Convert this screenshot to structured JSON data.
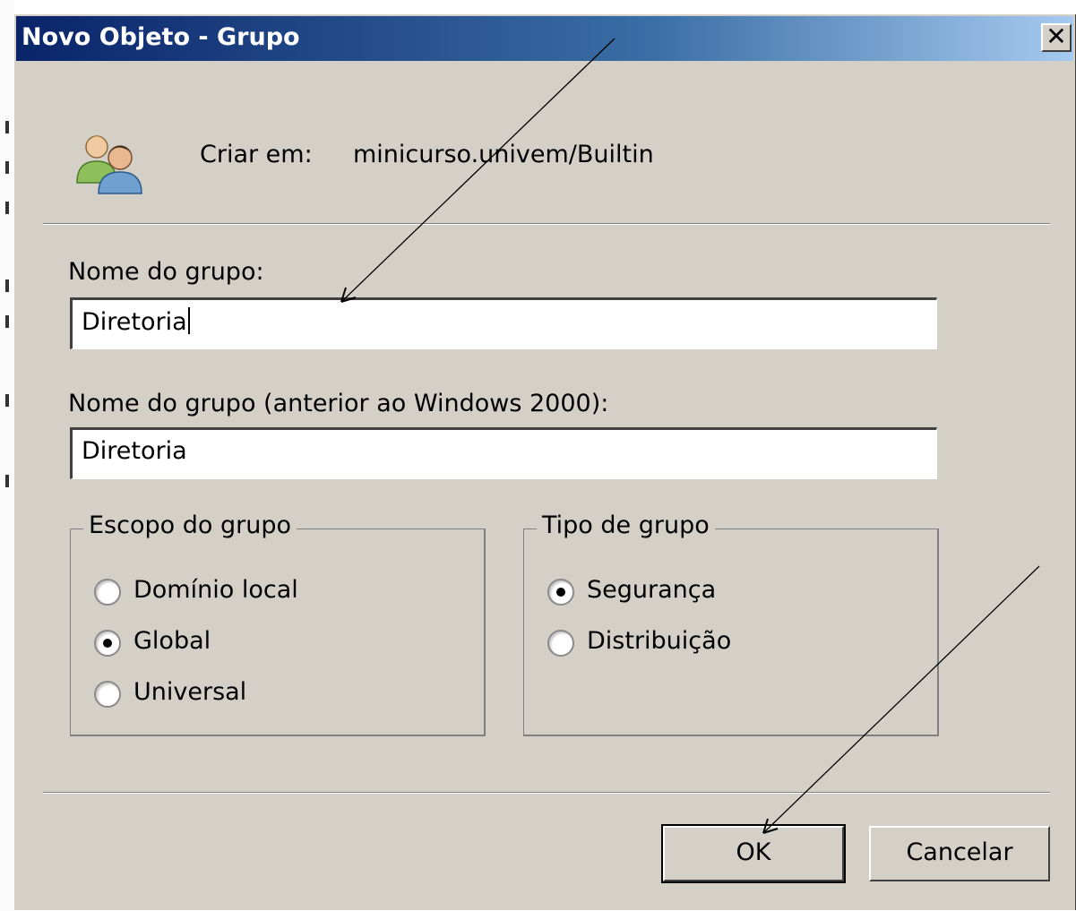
{
  "window": {
    "title": "Novo Objeto - Grupo",
    "close_label": "✕"
  },
  "header": {
    "icon": "users-icon",
    "create_in_label": "Criar em:",
    "create_in_value": "minicurso.univem/Builtin"
  },
  "form": {
    "group_name_label": "Nome do grupo:",
    "group_name_value": "Diretoria",
    "group_name_pre2000_label": "Nome do grupo (anterior ao Windows 2000):",
    "group_name_pre2000_value": "Diretoria"
  },
  "scope": {
    "legend": "Escopo do grupo",
    "options": [
      {
        "label": "Domínio local",
        "checked": false
      },
      {
        "label": "Global",
        "checked": true
      },
      {
        "label": "Universal",
        "checked": false
      }
    ]
  },
  "type": {
    "legend": "Tipo de grupo",
    "options": [
      {
        "label": "Segurança",
        "checked": true
      },
      {
        "label": "Distribuição",
        "checked": false
      }
    ]
  },
  "buttons": {
    "ok": "OK",
    "cancel": "Cancelar"
  },
  "colors": {
    "dialog_face": "#d4d0c8",
    "title_start": "#0a246a",
    "title_end": "#a6caf0"
  }
}
